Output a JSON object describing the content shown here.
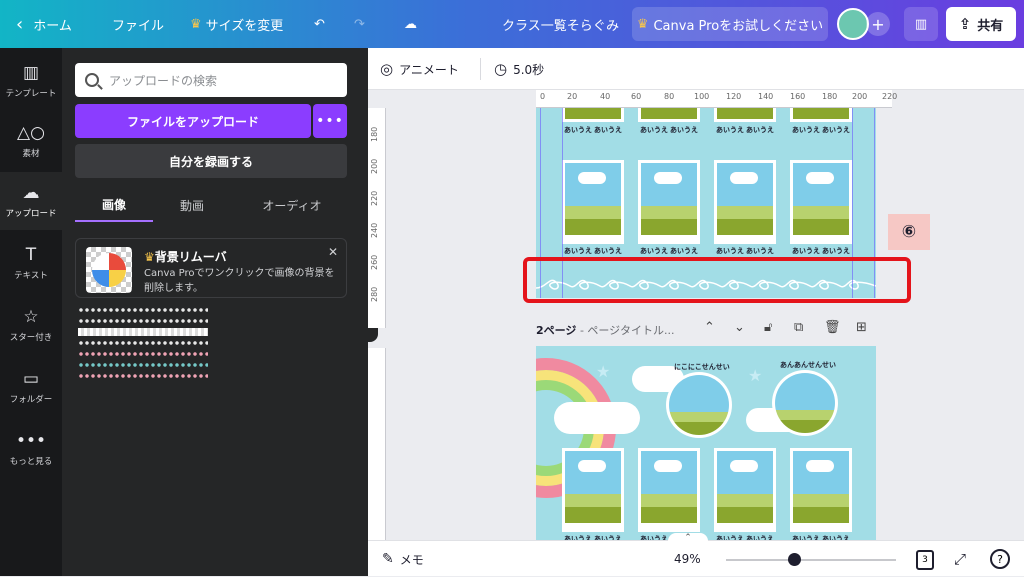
{
  "header": {
    "home": "ホーム",
    "file": "ファイル",
    "resize": "サイズを変更",
    "title": "クラス一覧そらぐみ",
    "pro": "Canva Proをお試しください",
    "share": "共有"
  },
  "rail": [
    {
      "label": "テンプレート",
      "icon": "▥"
    },
    {
      "label": "素材",
      "icon": "△○"
    },
    {
      "label": "アップロード",
      "icon": "☁"
    },
    {
      "label": "テキスト",
      "icon": "T"
    },
    {
      "label": "スター付き",
      "icon": "☆"
    },
    {
      "label": "フォルダー",
      "icon": "▭"
    },
    {
      "label": "もっと見る",
      "icon": "•••"
    }
  ],
  "panel": {
    "search_placeholder": "アップロードの検索",
    "upload": "ファイルをアップロード",
    "record": "自分を録画する",
    "tabs": [
      "画像",
      "動画",
      "オーディオ"
    ],
    "promo_title": "背景リムーバ",
    "promo_desc": "Canva Proでワンクリックで画像の背景を削除します。"
  },
  "toolbar": {
    "animate": "アニメート",
    "duration": "5.0秒"
  },
  "ruler": {
    "top": [
      "0",
      "20",
      "40",
      "60",
      "80",
      "100",
      "120",
      "140",
      "160",
      "180",
      "200",
      "220"
    ],
    "left": [
      "180",
      "200",
      "220",
      "240",
      "260",
      "280"
    ]
  },
  "canvas": {
    "name_label": "あいうえ",
    "annotation": "⑥",
    "page2_label": "2ページ",
    "page2_title": "- ページタイトル...",
    "teacher1": "にこにこせんせい",
    "teacher2": "あんあんせんせい"
  },
  "bottom": {
    "notes": "メモ",
    "zoom": "49%",
    "pages": "3",
    "help": "?"
  }
}
